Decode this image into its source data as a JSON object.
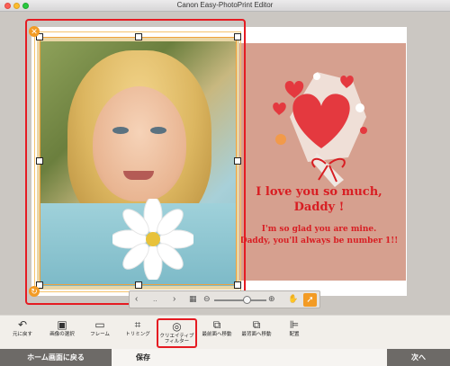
{
  "window": {
    "title": "Canon Easy-PhotoPrint Editor"
  },
  "message": {
    "line1": "I love you so much,",
    "line2": "Daddy !",
    "line3": "I'm so glad you are mine.",
    "line4": "Daddy, you'll always be number 1!!"
  },
  "toolbar": {
    "items": [
      {
        "label": "元に戻す",
        "icon": "undo-icon"
      },
      {
        "label": "画像の選択",
        "icon": "image-select-icon"
      },
      {
        "label": "フレーム",
        "icon": "frame-icon"
      },
      {
        "label": "トリミング",
        "icon": "crop-icon"
      },
      {
        "label": "クリエイティブ\nフィルター",
        "icon": "creative-filter-icon"
      },
      {
        "label": "最前面へ移動",
        "icon": "bring-to-front-icon"
      },
      {
        "label": "最背面へ移動",
        "icon": "send-to-back-icon"
      },
      {
        "label": "配置",
        "icon": "align-icon"
      }
    ]
  },
  "float_bar": {
    "page_indicator": "‥"
  },
  "bottom": {
    "home_label": "ホーム画面に戻る",
    "save_label": "保存",
    "next_label": "次へ"
  },
  "colors": {
    "accent": "#e51b22",
    "handle_orange": "#f39b24",
    "card_bg": "#d6a08f"
  }
}
